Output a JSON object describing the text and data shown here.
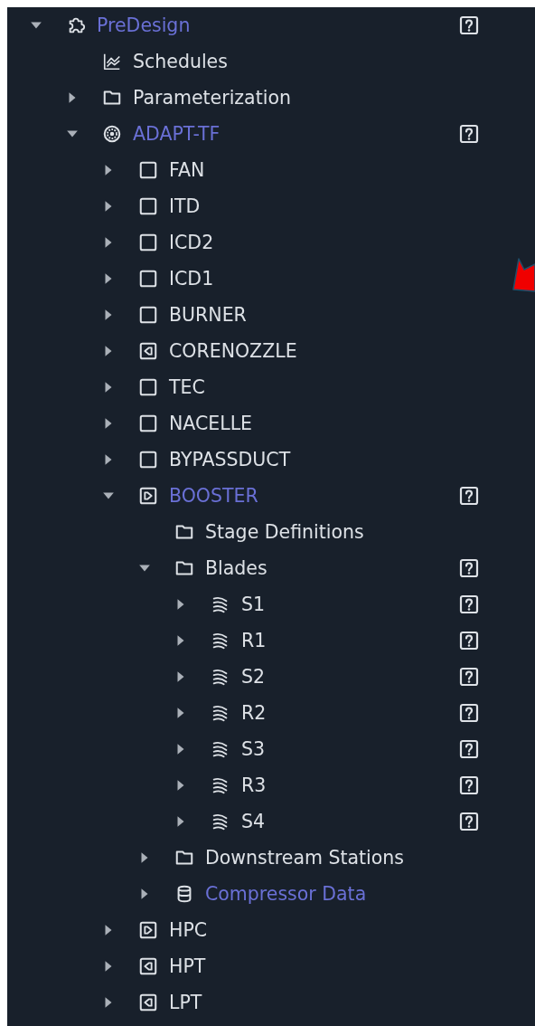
{
  "tree": [
    {
      "label": "PreDesign",
      "kind": "puzzle",
      "expanded": true,
      "highlighted": true,
      "help": true,
      "children": [
        {
          "label": "Schedules",
          "kind": "chart",
          "highlighted": false,
          "help": false
        },
        {
          "label": "Parameterization",
          "kind": "folder",
          "expanded": false,
          "highlighted": false,
          "help": false
        },
        {
          "label": "ADAPT-TF",
          "kind": "disc",
          "expanded": true,
          "highlighted": true,
          "help": true,
          "children": [
            {
              "label": "FAN",
              "kind": "square",
              "expanded": false,
              "highlighted": false,
              "help": false
            },
            {
              "label": "ITD",
              "kind": "square",
              "expanded": false,
              "highlighted": false,
              "help": false
            },
            {
              "label": "ICD2",
              "kind": "square",
              "expanded": false,
              "highlighted": false,
              "help": false
            },
            {
              "label": "ICD1",
              "kind": "square",
              "expanded": false,
              "highlighted": false,
              "help": false
            },
            {
              "label": "BURNER",
              "kind": "square",
              "expanded": false,
              "highlighted": false,
              "help": false
            },
            {
              "label": "CORENOZZLE",
              "kind": "outlet",
              "expanded": false,
              "highlighted": false,
              "help": false
            },
            {
              "label": "TEC",
              "kind": "square",
              "expanded": false,
              "highlighted": false,
              "help": false
            },
            {
              "label": "NACELLE",
              "kind": "square",
              "expanded": false,
              "highlighted": false,
              "help": false
            },
            {
              "label": "BYPASSDUCT",
              "kind": "square",
              "expanded": false,
              "highlighted": false,
              "help": false
            },
            {
              "label": "BOOSTER",
              "kind": "inlet",
              "expanded": true,
              "highlighted": true,
              "help": true,
              "children": [
                {
                  "label": "Stage Definitions",
                  "kind": "folder",
                  "highlighted": false,
                  "help": false
                },
                {
                  "label": "Blades",
                  "kind": "folder",
                  "expanded": true,
                  "highlighted": false,
                  "help": true,
                  "children": [
                    {
                      "label": "S1",
                      "kind": "blades",
                      "expanded": false,
                      "highlighted": false,
                      "help": true
                    },
                    {
                      "label": "R1",
                      "kind": "blades",
                      "expanded": false,
                      "highlighted": false,
                      "help": true
                    },
                    {
                      "label": "S2",
                      "kind": "blades",
                      "expanded": false,
                      "highlighted": false,
                      "help": true
                    },
                    {
                      "label": "R2",
                      "kind": "blades",
                      "expanded": false,
                      "highlighted": false,
                      "help": true
                    },
                    {
                      "label": "S3",
                      "kind": "blades",
                      "expanded": false,
                      "highlighted": false,
                      "help": true
                    },
                    {
                      "label": "R3",
                      "kind": "blades",
                      "expanded": false,
                      "highlighted": false,
                      "help": true
                    },
                    {
                      "label": "S4",
                      "kind": "blades",
                      "expanded": false,
                      "highlighted": false,
                      "help": true
                    }
                  ]
                },
                {
                  "label": "Downstream Stations",
                  "kind": "folder",
                  "expanded": false,
                  "highlighted": false,
                  "help": false
                },
                {
                  "label": "Compressor Data",
                  "kind": "database",
                  "expanded": false,
                  "highlighted": true,
                  "help": false
                }
              ]
            },
            {
              "label": "HPC",
              "kind": "inlet",
              "expanded": false,
              "highlighted": false,
              "help": false
            },
            {
              "label": "HPT",
              "kind": "outlet",
              "expanded": false,
              "highlighted": false,
              "help": false
            },
            {
              "label": "LPT",
              "kind": "outlet",
              "expanded": false,
              "highlighted": false,
              "help": false
            }
          ]
        }
      ]
    }
  ],
  "annotation": {
    "arrow": true
  }
}
